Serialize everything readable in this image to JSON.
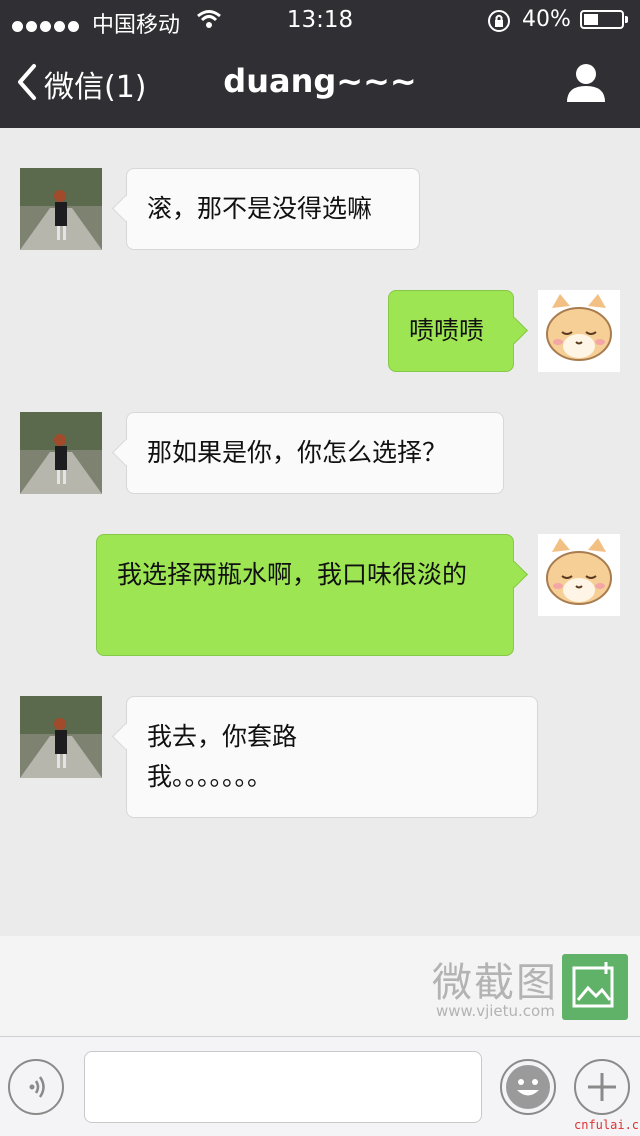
{
  "status_bar": {
    "carrier": "中国移动",
    "time": "13:18",
    "battery_percent": "40%",
    "battery_level": 0.4
  },
  "nav": {
    "back_label": "微信(1)",
    "title": "duang~~~"
  },
  "messages": [
    {
      "side": "in",
      "text": "滚，那不是没得选嘛"
    },
    {
      "side": "out",
      "text": "啧啧啧"
    },
    {
      "side": "in",
      "text": "那如果是你，你怎么选择？"
    },
    {
      "side": "out",
      "text": "我选择两瓶水啊，我口味很淡的"
    },
    {
      "side": "in",
      "text": "我去，你套路\n我。。。。。。。"
    }
  ],
  "watermark": {
    "title": "微截图",
    "url": "www.vjietu.com",
    "corner": "cnfulai.cn"
  },
  "input_bar": {
    "value": "",
    "placeholder": ""
  },
  "colors": {
    "header_bg": "#2f2f34",
    "chat_bg": "#ebebeb",
    "outgoing_bubble": "#9de553",
    "incoming_bubble": "#fafafa",
    "watermark_logo": "#5fb268"
  }
}
